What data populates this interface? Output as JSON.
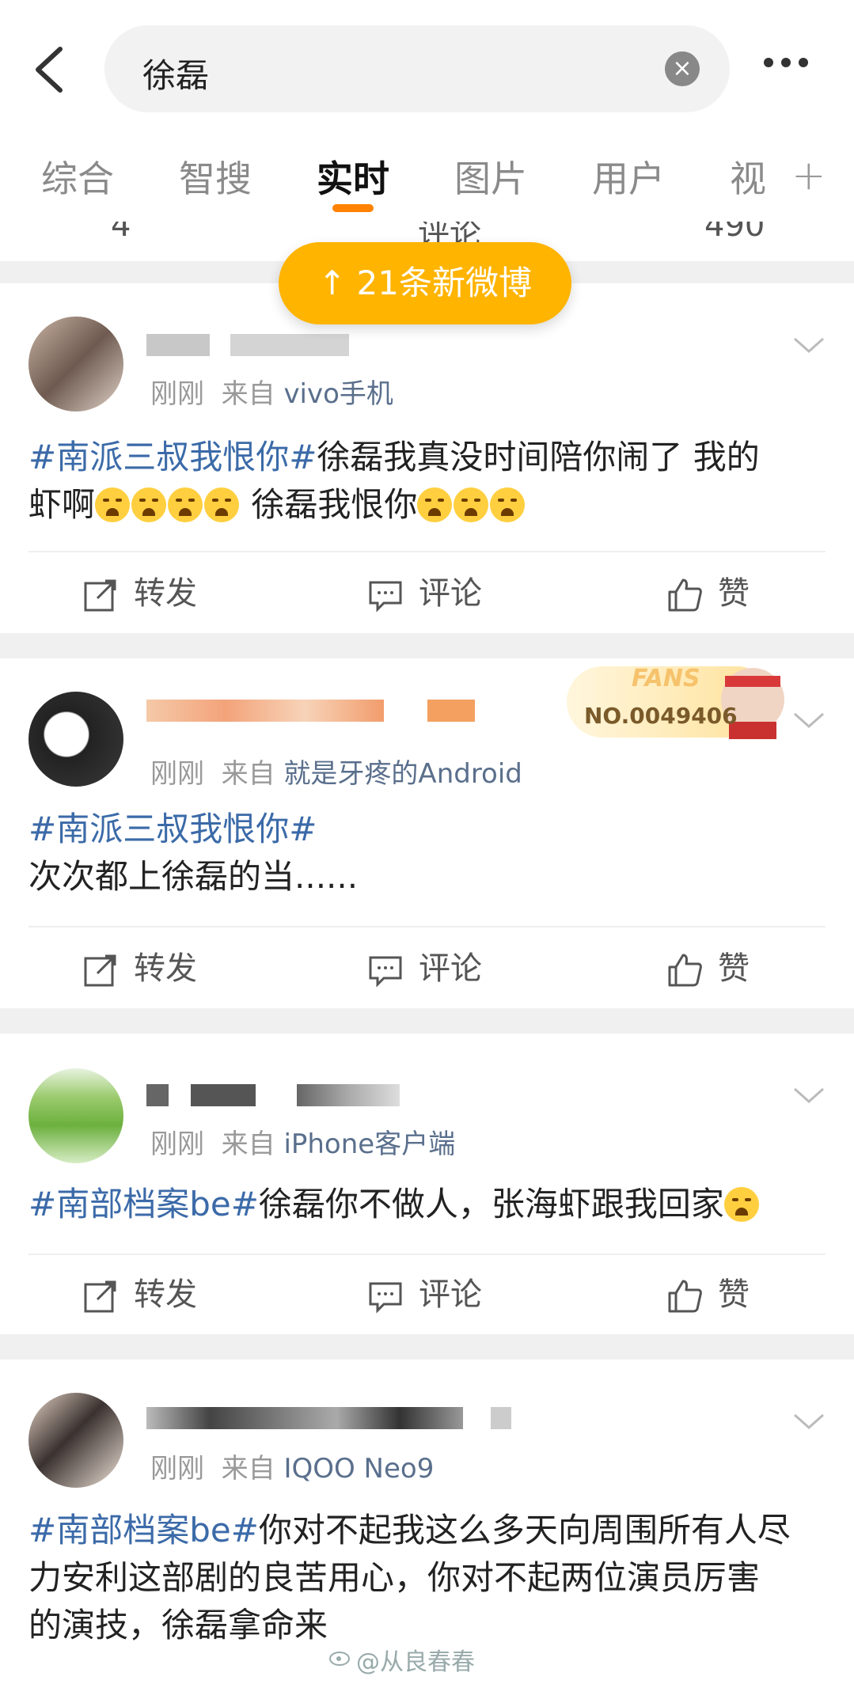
{
  "search": {
    "query": "徐磊"
  },
  "tabs": [
    "综合",
    "智搜",
    "实时",
    "图片",
    "用户",
    "视"
  ],
  "active_tab": "实时",
  "prev_actions": {
    "repost": "4",
    "comment": "评论",
    "like": "490"
  },
  "new_posts_pill": "21条新微博",
  "actions": {
    "repost": "转发",
    "comment": "评论",
    "like": "赞"
  },
  "posts": [
    {
      "time": "刚刚",
      "from_prefix": "来自",
      "source": "vivo手机",
      "tag": "#南派三叔我恨你#",
      "text1": "徐磊我真没时间陪你闹了 我的",
      "text2": "虾啊",
      "text3": " 徐磊我恨你"
    },
    {
      "time": "刚刚",
      "from_prefix": "来自",
      "source": "就是牙疼的Android",
      "tag": "#南派三叔我恨你#",
      "text1": "次次都上徐磊的当......",
      "fans_badge": {
        "label": "FANS",
        "number": "NO.0049406"
      }
    },
    {
      "time": "刚刚",
      "from_prefix": "来自",
      "source": "iPhone客户端",
      "tag": "#南部档案be#",
      "text1": "徐磊你不做人，张海虾跟我回家"
    },
    {
      "time": "刚刚",
      "from_prefix": "来自",
      "source": "IQOO Neo9",
      "tag": "#南部档案be#",
      "text1": "你对不起我这么多天向周围所有人尽",
      "text2": "力安利这部剧的良苦用心，你对不起两位演员厉害",
      "text3": "的演技，徐磊拿命来"
    }
  ],
  "watermark": "@从良春春"
}
